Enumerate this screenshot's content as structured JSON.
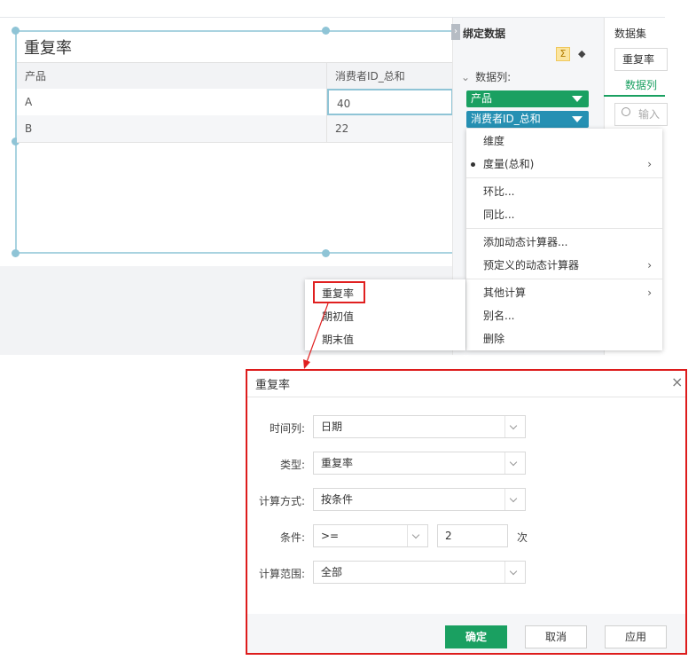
{
  "report": {
    "title": "重复率",
    "columns": [
      "产品",
      "消费者ID_总和"
    ],
    "rows": [
      [
        "A",
        "40"
      ],
      [
        "B",
        "22"
      ]
    ]
  },
  "binding_panel": {
    "title": "绑定数据",
    "data_columns_label": "数据列:",
    "fields": [
      {
        "label": "产品",
        "color": "#1aa061"
      },
      {
        "label": "消费者ID_总和",
        "color": "#2690b3"
      }
    ],
    "sigma_icon": "Σ"
  },
  "dataset_panel": {
    "title": "数据集",
    "selected": "重复率",
    "tab": "数据列",
    "search_placeholder": "输入搜"
  },
  "context_menu": {
    "items": [
      {
        "label": "维度"
      },
      {
        "label": "度量(总和)",
        "checked": true,
        "submenu": true
      },
      {
        "label": "环比..."
      },
      {
        "label": "同比..."
      },
      {
        "label": "添加动态计算器..."
      },
      {
        "label": "预定义的动态计算器",
        "submenu": true
      },
      {
        "label": "其他计算",
        "submenu": true
      },
      {
        "label": "别名..."
      },
      {
        "label": "删除"
      }
    ]
  },
  "submenu": {
    "items": [
      "重复率",
      "期初值",
      "期末值"
    ]
  },
  "dialog": {
    "title": "重复率",
    "fields": {
      "time_column": {
        "label": "时间列:",
        "value": "日期"
      },
      "type": {
        "label": "类型:",
        "value": "重复率"
      },
      "calc_method": {
        "label": "计算方式:",
        "value": "按条件"
      },
      "condition": {
        "label": "条件:",
        "operator": ">=",
        "value": "2",
        "unit": "次"
      },
      "calc_range": {
        "label": "计算范围:",
        "value": "全部"
      }
    },
    "buttons": {
      "ok": "确定",
      "cancel": "取消",
      "apply": "应用"
    }
  },
  "colors": {
    "accent": "#1aa061",
    "highlight": "#e02020",
    "selection": "#8fc4d6"
  }
}
